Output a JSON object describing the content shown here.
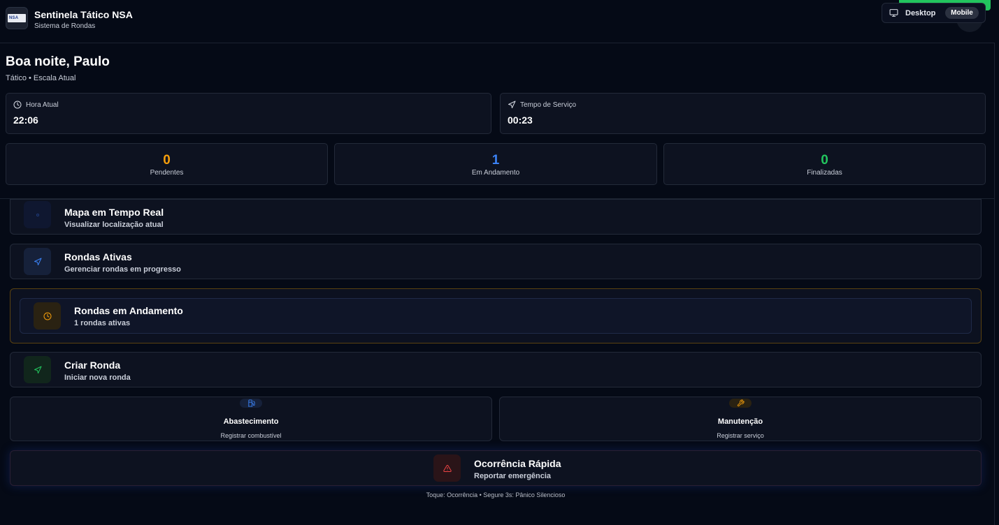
{
  "header": {
    "logo_text": "NSA",
    "title": "Sentinela Tático NSA",
    "subtitle": "Sistema de Rondas"
  },
  "view_toggle": {
    "desktop_label": "Desktop",
    "mobile_label": "Mobile",
    "selected": "Mobile"
  },
  "greeting": {
    "title": "Boa noite, Paulo",
    "role": "Tático • Escala Atual"
  },
  "info": {
    "time_label": "Hora Atual",
    "time_value": "22:06",
    "service_label": "Tempo de Serviço",
    "service_value": "00:23"
  },
  "stats": [
    {
      "value": "0",
      "label": "Pendentes",
      "color": "#f59e0b"
    },
    {
      "value": "1",
      "label": "Em Andamento",
      "color": "#3b82f6"
    },
    {
      "value": "0",
      "label": "Finalizadas",
      "color": "#22c55e"
    }
  ],
  "menu": [
    {
      "title": "Mapa em Tempo Real",
      "subtitle": "Visualizar localização atual",
      "icon": "map-icon"
    },
    {
      "title": "Rondas Ativas",
      "subtitle": "Gerenciar rondas em progresso",
      "icon": "navigation-icon"
    },
    {
      "title": "Rondas em Andamento",
      "subtitle": "1 rondas ativas",
      "icon": "clock-icon"
    },
    {
      "title": "Criar Ronda",
      "subtitle": "Iniciar nova ronda",
      "icon": "navigation-icon"
    }
  ],
  "quick_actions": [
    {
      "title": "Abastecimento",
      "subtitle": "Registrar combustível",
      "icon": "fuel-icon"
    },
    {
      "title": "Manutenção",
      "subtitle": "Registrar serviço",
      "icon": "wrench-icon"
    }
  ],
  "emergency": {
    "title": "Ocorrência Rápida",
    "subtitle": "Reportar emergência",
    "icon": "alert-triangle-icon",
    "hint": "Toque: Ocorrência • Segure 3s: Pânico Silencioso"
  },
  "colors": {
    "accent_blue": "#3b82f6",
    "accent_orange": "#f59e0b",
    "accent_green": "#22c55e",
    "accent_red": "#ef4444",
    "background": "#050a16"
  }
}
